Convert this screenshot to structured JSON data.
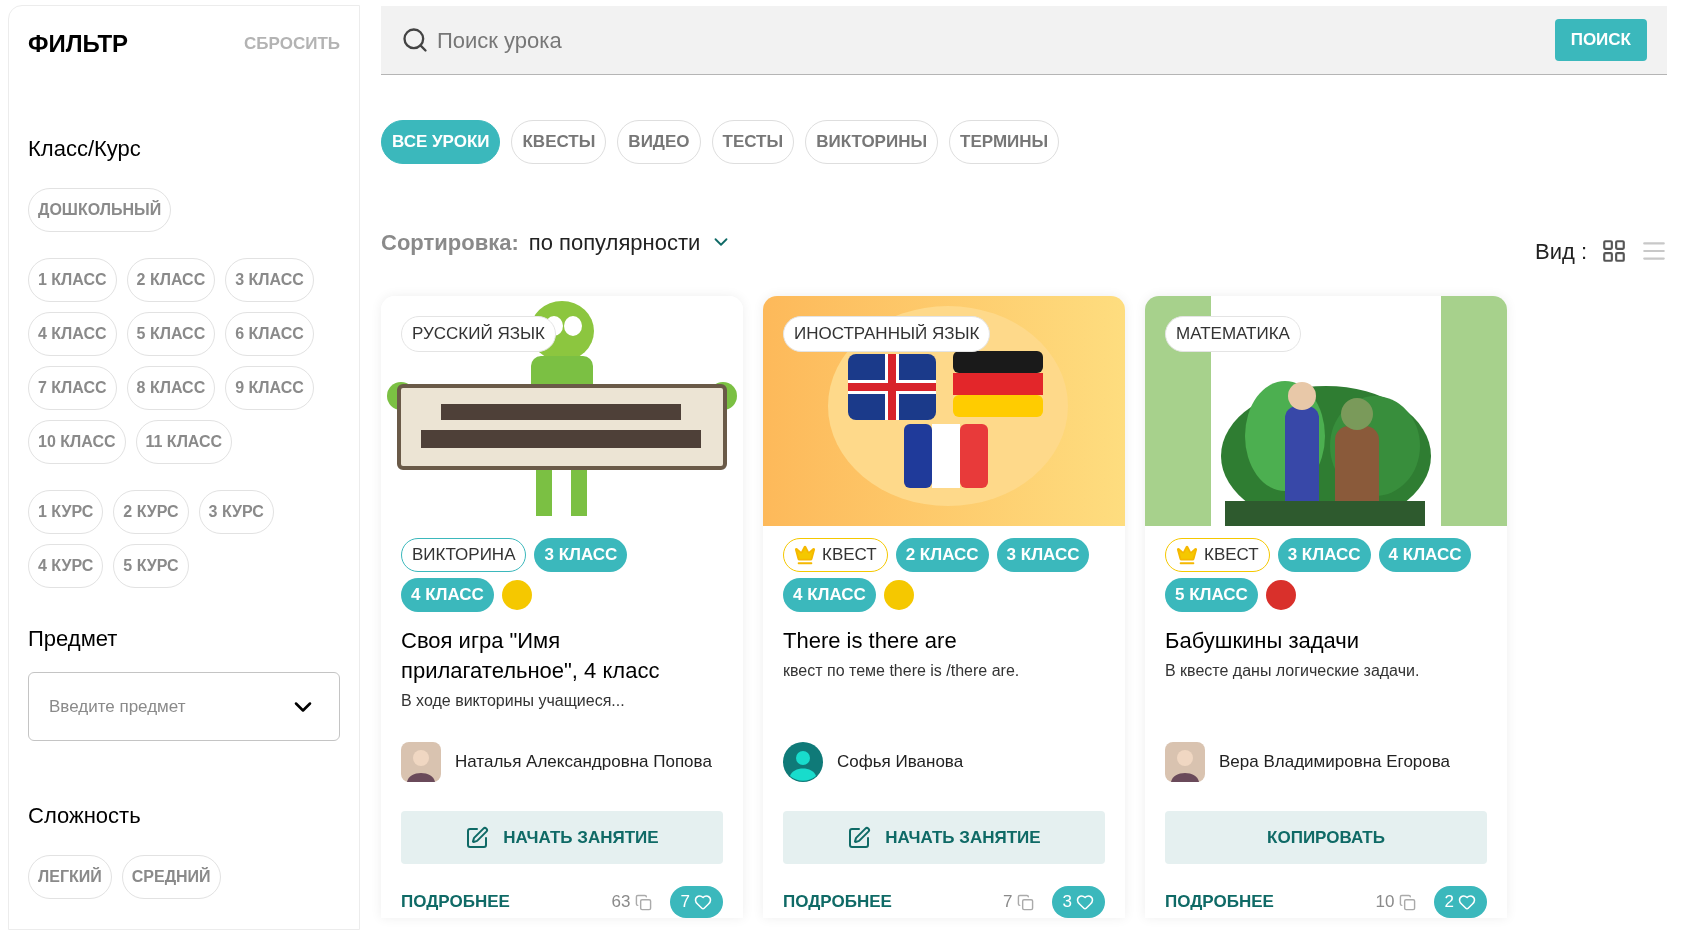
{
  "filter": {
    "title": "ФИЛЬТР",
    "reset": "СБРОСИТЬ",
    "sections": [
      {
        "kind": "chips",
        "title": "Класс/Курс",
        "groups": [
          [
            {
              "label": "ДОШКОЛЬНЫЙ",
              "selected": false
            }
          ],
          [
            {
              "label": "1 КЛАСС",
              "selected": false
            },
            {
              "label": "2 КЛАСС",
              "selected": false
            },
            {
              "label": "3 КЛАСС",
              "selected": false
            },
            {
              "label": "4 КЛАСС",
              "selected": false
            },
            {
              "label": "5 КЛАСС",
              "selected": false
            },
            {
              "label": "6 КЛАСС",
              "selected": false
            },
            {
              "label": "7 КЛАСС",
              "selected": false
            },
            {
              "label": "8 КЛАСС",
              "selected": false
            },
            {
              "label": "9 КЛАСС",
              "selected": false
            },
            {
              "label": "10 КЛАСС",
              "selected": false
            },
            {
              "label": "11 КЛАСС",
              "selected": false
            }
          ],
          [
            {
              "label": "1 КУРС",
              "selected": false
            },
            {
              "label": "2 КУРС",
              "selected": false
            },
            {
              "label": "3 КУРС",
              "selected": false
            },
            {
              "label": "4 КУРС",
              "selected": false
            },
            {
              "label": "5 КУРС",
              "selected": false
            }
          ]
        ]
      },
      {
        "kind": "select",
        "title": "Предмет",
        "placeholder": "Введите предмет"
      },
      {
        "kind": "chips",
        "title": "Сложность",
        "groups": [
          [
            {
              "label": "ЛЕГКИЙ",
              "selected": false
            },
            {
              "label": "СРЕДНИЙ",
              "selected": false
            }
          ]
        ]
      }
    ]
  },
  "search": {
    "placeholder": "Поиск урока",
    "button": "ПОИСК"
  },
  "tabs": [
    {
      "label": "ВСЕ УРОКИ",
      "selected": true
    },
    {
      "label": "КВЕСТЫ",
      "selected": false
    },
    {
      "label": "ВИДЕО",
      "selected": false
    },
    {
      "label": "ТЕСТЫ",
      "selected": false
    },
    {
      "label": "ВИКТОРИНЫ",
      "selected": false
    },
    {
      "label": "ТЕРМИНЫ",
      "selected": false
    }
  ],
  "sort": {
    "label": "Сортировка:",
    "value": "по популярности"
  },
  "view": {
    "label": "Вид :",
    "options": [
      {
        "kind": "grid",
        "selected": true
      },
      {
        "kind": "list",
        "selected": false
      }
    ]
  },
  "cards": [
    {
      "subject": "РУССКИЙ ЯЗЫК",
      "type": {
        "label": "ВИКТОРИНА",
        "premium": false
      },
      "grades": [
        "3 КЛАСС",
        "4 КЛАСС"
      ],
      "difficulty": {
        "color": "#f5c800"
      },
      "title": "Своя игра \"Имя прилагательное\", 4 класс",
      "description": "В ходе викторины учащиеся...",
      "author": {
        "name": "Наталья Александровна Попова",
        "has_photo": true
      },
      "action": {
        "label": "НАЧАТЬ ЗАНЯТИЕ",
        "icon": true
      },
      "more": "ПОДРОБНЕЕ",
      "copies": "63",
      "likes": "7"
    },
    {
      "subject": "ИНОСТРАННЫЙ ЯЗЫК",
      "type": {
        "label": "КВЕСТ",
        "premium": true
      },
      "grades": [
        "2 КЛАСС",
        "3 КЛАСС",
        "4 КЛАСС"
      ],
      "difficulty": {
        "color": "#f5c800"
      },
      "title": "There is there are",
      "description": "квест по теме there is /there are.",
      "author": {
        "name": "Софья Иванова",
        "has_photo": false
      },
      "action": {
        "label": "НАЧАТЬ ЗАНЯТИЕ",
        "icon": true
      },
      "more": "ПОДРОБНЕЕ",
      "copies": "7",
      "likes": "3"
    },
    {
      "subject": "МАТЕМАТИКА",
      "type": {
        "label": "КВЕСТ",
        "premium": true
      },
      "grades": [
        "3 КЛАСС",
        "4 КЛАСС",
        "5 КЛАСС"
      ],
      "difficulty": {
        "color": "#d9302b"
      },
      "title": "Бабушкины задачи",
      "description": "В квесте даны логические задачи.",
      "author": {
        "name": "Вера Владимировна Егорова",
        "has_photo": true
      },
      "action": {
        "label": "КОПИРОВАТЬ",
        "icon": false
      },
      "more": "ПОДРОБНЕЕ",
      "copies": "10",
      "likes": "2"
    }
  ]
}
